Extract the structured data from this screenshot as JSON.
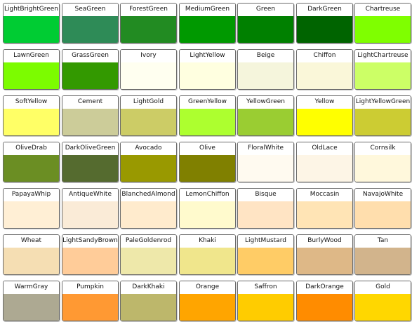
{
  "swatches": [
    {
      "name": "LightBrightGreen",
      "color": "#00CC33"
    },
    {
      "name": "SeaGreen",
      "color": "#2E8B57"
    },
    {
      "name": "ForestGreen",
      "color": "#228B22"
    },
    {
      "name": "MediumGreen",
      "color": "#009900"
    },
    {
      "name": "Green",
      "color": "#008000"
    },
    {
      "name": "DarkGreen",
      "color": "#006400"
    },
    {
      "name": "Chartreuse",
      "color": "#7FFF00"
    },
    {
      "name": "LawnGreen",
      "color": "#7CFC00"
    },
    {
      "name": "GrassGreen",
      "color": "#339900"
    },
    {
      "name": "Ivory",
      "color": "#FFFFF0"
    },
    {
      "name": "LightYellow",
      "color": "#FFFFE0"
    },
    {
      "name": "Beige",
      "color": "#F5F5DC"
    },
    {
      "name": "Chiffon",
      "color": "#FAF7D9"
    },
    {
      "name": "LightChartreuse",
      "color": "#CCFF66"
    },
    {
      "name": "SoftYellow",
      "color": "#FFFF66"
    },
    {
      "name": "Cement",
      "color": "#CCCC99"
    },
    {
      "name": "LightGold",
      "color": "#CCCC66"
    },
    {
      "name": "GreenYellow",
      "color": "#ADFF2F"
    },
    {
      "name": "YellowGreen",
      "color": "#9ACD32"
    },
    {
      "name": "Yellow",
      "color": "#FFFF00"
    },
    {
      "name": "LightYellowGreen",
      "color": "#CCCC33"
    },
    {
      "name": "OliveDrab",
      "color": "#6B8E23"
    },
    {
      "name": "DarkOliveGreen",
      "color": "#556B2F"
    },
    {
      "name": "Avocado",
      "color": "#999900"
    },
    {
      "name": "Olive",
      "color": "#808000"
    },
    {
      "name": "FloralWhite",
      "color": "#FFFAF0"
    },
    {
      "name": "OldLace",
      "color": "#FDF5E6"
    },
    {
      "name": "Cornsilk",
      "color": "#FFF8DC"
    },
    {
      "name": "PapayaWhip",
      "color": "#FFEFD5"
    },
    {
      "name": "AntiqueWhite",
      "color": "#FAEBD7"
    },
    {
      "name": "BlanchedAlmond",
      "color": "#FFEBCD"
    },
    {
      "name": "LemonChiffon",
      "color": "#FFFACD"
    },
    {
      "name": "Bisque",
      "color": "#FFE4C4"
    },
    {
      "name": "Moccasin",
      "color": "#FFE4B5"
    },
    {
      "name": "NavajoWhite",
      "color": "#FFDEAD"
    },
    {
      "name": "Wheat",
      "color": "#F5DEB3"
    },
    {
      "name": "LightSandyBrown",
      "color": "#FFCC99"
    },
    {
      "name": "PaleGoldenrod",
      "color": "#EEE8AA"
    },
    {
      "name": "Khaki",
      "color": "#F0E68C"
    },
    {
      "name": "LightMustard",
      "color": "#FFCC66"
    },
    {
      "name": "BurlyWood",
      "color": "#DEB887"
    },
    {
      "name": "Tan",
      "color": "#D2B48C"
    },
    {
      "name": "WarmGray",
      "color": "#ADA992"
    },
    {
      "name": "Pumpkin",
      "color": "#FF9933"
    },
    {
      "name": "DarkKhaki",
      "color": "#BDB76B"
    },
    {
      "name": "Orange",
      "color": "#FFA500"
    },
    {
      "name": "Saffron",
      "color": "#FFCC00"
    },
    {
      "name": "DarkOrange",
      "color": "#FF8C00"
    },
    {
      "name": "Gold",
      "color": "#FFD700"
    }
  ]
}
